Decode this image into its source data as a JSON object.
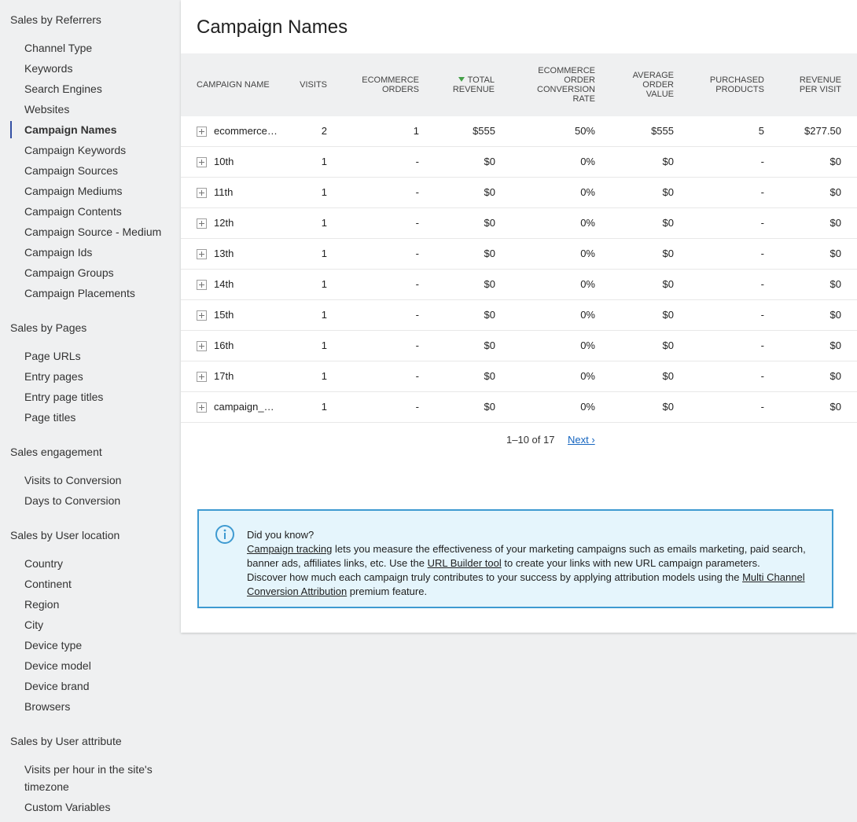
{
  "sidebar": {
    "sections": [
      {
        "title": "Sales by Referrers",
        "items": [
          "Channel Type",
          "Keywords",
          "Search Engines",
          "Websites",
          "Campaign Names",
          "Campaign Keywords",
          "Campaign Sources",
          "Campaign Mediums",
          "Campaign Contents",
          "Campaign Source - Medium",
          "Campaign Ids",
          "Campaign Groups",
          "Campaign Placements"
        ]
      },
      {
        "title": "Sales by Pages",
        "items": [
          "Page URLs",
          "Entry pages",
          "Entry page titles",
          "Page titles"
        ]
      },
      {
        "title": "Sales engagement",
        "items": [
          "Visits to Conversion",
          "Days to Conversion"
        ]
      },
      {
        "title": "Sales by User location",
        "items": [
          "Country",
          "Continent",
          "Region",
          "City",
          "Device type",
          "Device model",
          "Device brand",
          "Browsers"
        ]
      },
      {
        "title": "Sales by User attribute",
        "items": [
          "Visits per hour in the site's timezone",
          "Custom Variables"
        ]
      }
    ],
    "active_item": "Campaign Names"
  },
  "main": {
    "title": "Campaign Names",
    "columns": {
      "label": "CAMPAIGN NAME",
      "visits": "VISITS",
      "orders_l1": "ECOMMERCE",
      "orders_l2": "ORDERS",
      "revenue_l1": "TOTAL",
      "revenue_l2": "REVENUE",
      "conv_l1": "ECOMMERCE",
      "conv_l2": "ORDER",
      "conv_l3": "CONVERSION",
      "conv_l4": "RATE",
      "aov_l1": "AVERAGE",
      "aov_l2": "ORDER",
      "aov_l3": "VALUE",
      "products_l1": "PURCHASED",
      "products_l2": "PRODUCTS",
      "rpv_l1": "REVENUE",
      "rpv_l2": "PER VISIT"
    },
    "rows": [
      {
        "label": "ecommerce…",
        "visits": "2",
        "orders": "1",
        "revenue": "$555",
        "conv": "50%",
        "aov": "$555",
        "products": "5",
        "rpv": "$277.50"
      },
      {
        "label": "10th",
        "visits": "1",
        "orders": "-",
        "revenue": "$0",
        "conv": "0%",
        "aov": "$0",
        "products": "-",
        "rpv": "$0"
      },
      {
        "label": "11th",
        "visits": "1",
        "orders": "-",
        "revenue": "$0",
        "conv": "0%",
        "aov": "$0",
        "products": "-",
        "rpv": "$0"
      },
      {
        "label": "12th",
        "visits": "1",
        "orders": "-",
        "revenue": "$0",
        "conv": "0%",
        "aov": "$0",
        "products": "-",
        "rpv": "$0"
      },
      {
        "label": "13th",
        "visits": "1",
        "orders": "-",
        "revenue": "$0",
        "conv": "0%",
        "aov": "$0",
        "products": "-",
        "rpv": "$0"
      },
      {
        "label": "14th",
        "visits": "1",
        "orders": "-",
        "revenue": "$0",
        "conv": "0%",
        "aov": "$0",
        "products": "-",
        "rpv": "$0"
      },
      {
        "label": "15th",
        "visits": "1",
        "orders": "-",
        "revenue": "$0",
        "conv": "0%",
        "aov": "$0",
        "products": "-",
        "rpv": "$0"
      },
      {
        "label": "16th",
        "visits": "1",
        "orders": "-",
        "revenue": "$0",
        "conv": "0%",
        "aov": "$0",
        "products": "-",
        "rpv": "$0"
      },
      {
        "label": "17th",
        "visits": "1",
        "orders": "-",
        "revenue": "$0",
        "conv": "0%",
        "aov": "$0",
        "products": "-",
        "rpv": "$0"
      },
      {
        "label": "campaign_…",
        "visits": "1",
        "orders": "-",
        "revenue": "$0",
        "conv": "0%",
        "aov": "$0",
        "products": "-",
        "rpv": "$0"
      }
    ],
    "pagination": {
      "info": "1–10 of 17",
      "next": "Next ›"
    }
  },
  "info_box": {
    "heading": "Did you know?",
    "link1": "Campaign tracking",
    "text1": " lets you measure the effectiveness of your marketing campaigns such as emails marketing, paid search, banner ads, affiliates links, etc. Use the ",
    "link2": "URL Builder tool",
    "text2": " to create your links with new URL campaign parameters.",
    "text3": "Discover how much each campaign truly contributes to your success by applying attribution models using the ",
    "link3": "Multi Channel Conversion Attribution",
    "text4": " premium feature."
  },
  "icons": {
    "expand": "plus-square-icon",
    "info": "info-circle-icon",
    "sort": "sort-desc-arrow-icon"
  },
  "colors": {
    "accent": "#3450a3",
    "sort_arrow": "#43a047",
    "link": "#1565c0",
    "info_border": "#3e9ad1",
    "info_bg": "#e5f5fc"
  }
}
